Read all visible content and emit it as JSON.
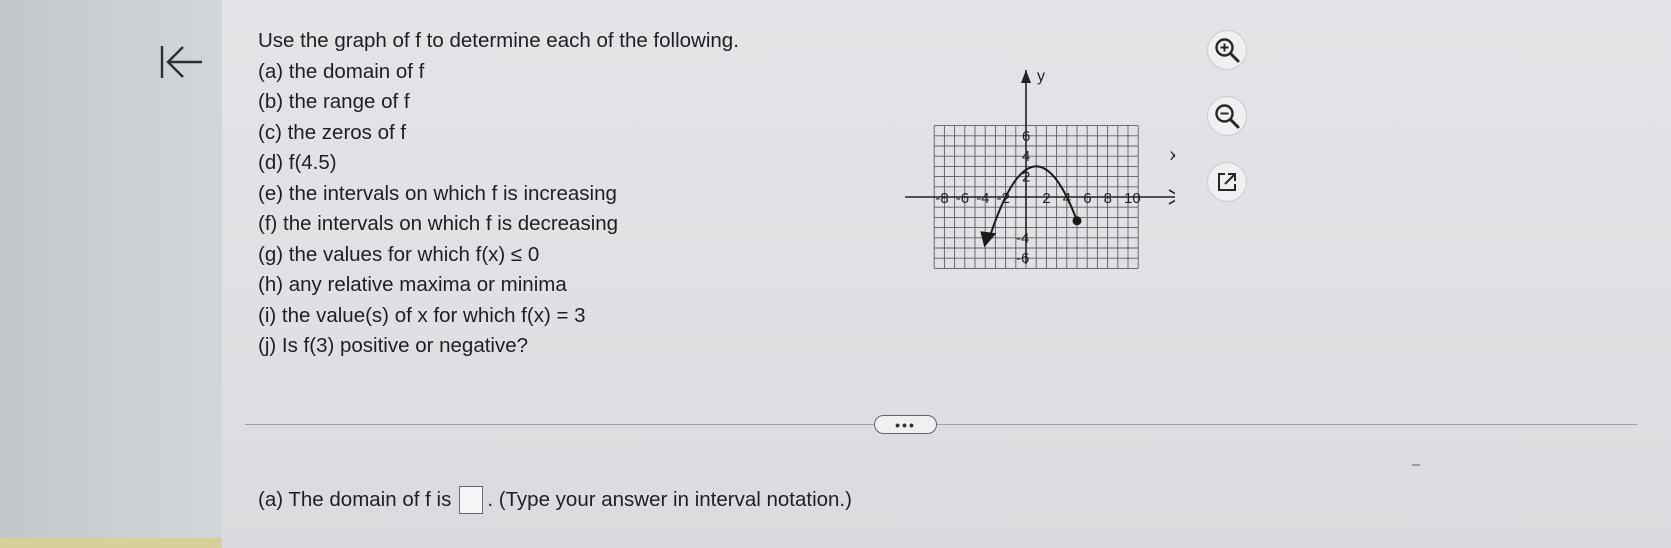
{
  "question": {
    "title": "Use the graph of f to determine each of the following.",
    "parts": [
      "(a) the domain of f",
      "(b) the range of f",
      "(c) the zeros of f",
      "(d) f(4.5)",
      "(e) the intervals on which f is increasing",
      "(f) the intervals on which f is decreasing",
      "(g) the values for which f(x) ≤ 0",
      "(h) any relative maxima or minima",
      "(i) the value(s) of x for which f(x) = 3",
      "(j) Is f(3) positive or negative?"
    ]
  },
  "graph": {
    "x_axis_label": "x",
    "y_axis_label": "y",
    "x_tick_labels": [
      "-8",
      "-6",
      "-4",
      "-2",
      "2",
      "4",
      "6",
      "8",
      "10"
    ],
    "y_tick_labels": [
      "6",
      "4",
      "2",
      "-4",
      "-6"
    ],
    "curve_color": "#1a1a1a"
  },
  "tools": {
    "zoom_in_icon": "zoom-in-icon",
    "zoom_out_icon": "zoom-out-icon",
    "open_external_icon": "open-external-icon"
  },
  "more_button_label": "•••",
  "answer": {
    "prefix": "(a) The domain of f is",
    "suffix": ". (Type your answer in interval notation.)"
  },
  "colors": {
    "background": "#e0e2e5",
    "text": "#1d1f22",
    "grid": "#5a5e63"
  }
}
